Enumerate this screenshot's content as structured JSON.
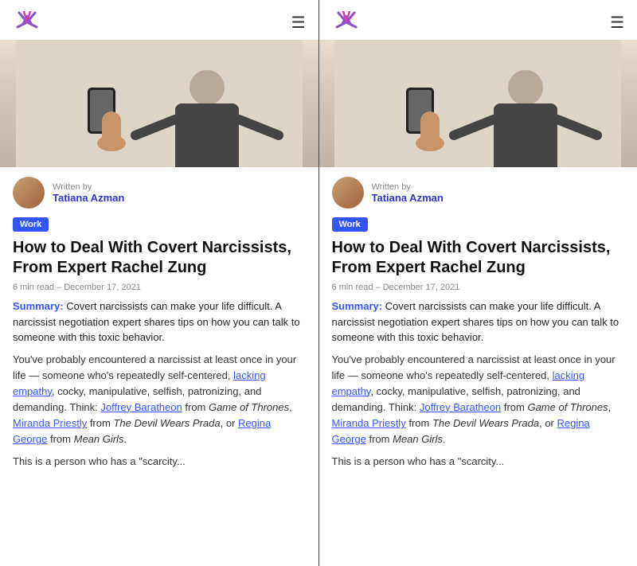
{
  "panels": [
    {
      "id": "left",
      "header": {
        "logo_alt": "Wort logo",
        "menu_label": "☰"
      },
      "author": {
        "written_by": "Written by",
        "name": "Tatiana Azman"
      },
      "tag": "Work",
      "title": "How to Deal With Covert Narcissists, From Expert Rachel Zung",
      "meta": "6 min read  –  December 17, 2021",
      "summary_label": "Summary:",
      "summary": " Covert narcissists can make your life difficult. A narcissist negotiation expert shares tips on how you can talk to someone with this toxic behavior.",
      "body1": "You've probably encountered a narcissist at least once in your life — someone who's repeatedly self-centered, ",
      "link1": "lacking empathy",
      "body2": ", cocky, manipulative, selfish, patronizing, and demanding. Think: ",
      "link2": "Joffrey Baratheon",
      "body3": " from ",
      "italic1": "Game of Thrones",
      "body4": ", ",
      "link3": "Miranda Priestly",
      "body5": " from ",
      "italic2": "The Devil Wears Prada",
      "body6": ", or ",
      "link4": "Regina George",
      "body7": " from ",
      "italic3": "Mean Girls",
      "body8": ".",
      "body9": "This is a person who has a \"scarcity..."
    },
    {
      "id": "right",
      "header": {
        "logo_alt": "Wort logo",
        "menu_label": "☰"
      },
      "author": {
        "written_by": "Written by",
        "name": "Tatiana Azman"
      },
      "tag": "Work",
      "title": "How to Deal With Covert Narcissists, From Expert Rachel Zung",
      "meta": "6 min read  –  December 17, 2021",
      "summary_label": "Summary:",
      "summary": " Covert narcissists can make your life difficult. A narcissist negotiation expert shares tips on how you can talk to someone with this toxic behavior.",
      "body1": "You've probably encountered a narcissist at least once in your life — someone who's repeatedly self-centered, ",
      "link1": "lacking empathy",
      "body2": ", cocky, manipulative, selfish, patronizing, and demanding. Think: ",
      "link2": "Joffrey Baratheon",
      "body3": " from ",
      "italic1": "Game of Thrones",
      "body4": ", ",
      "link3": "Miranda Priestly",
      "body5": " from ",
      "italic2": "The Devil Wears Prada",
      "body6": ", or ",
      "link4": "Regina George",
      "body7": " from ",
      "italic3": "Mean Girls",
      "body8": ".",
      "body9": "This is a person who has a \"scarcity..."
    }
  ],
  "colors": {
    "accent": "#3355ff",
    "tag_bg": "#3355ff",
    "author_name": "#3355ff",
    "link": "#3355ff"
  }
}
